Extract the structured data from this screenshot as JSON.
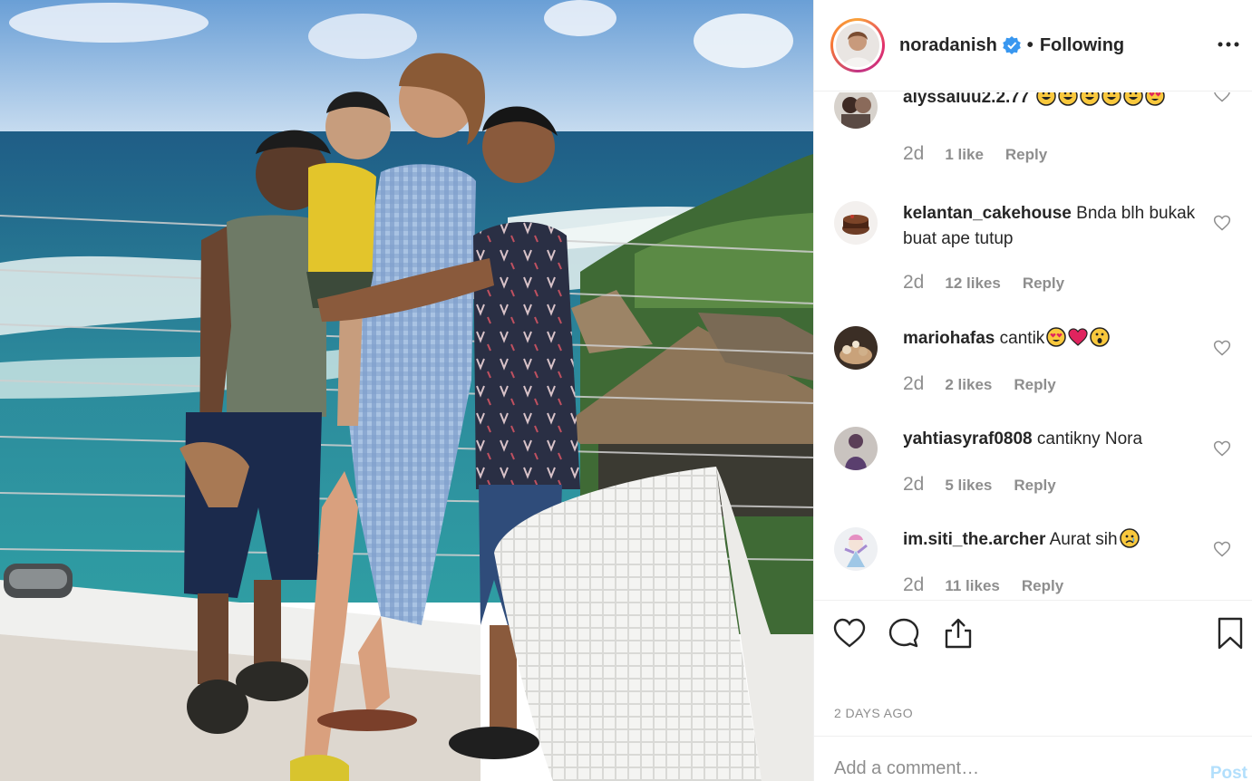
{
  "header": {
    "username": "noradanish",
    "separator": "•",
    "follow_status": "Following"
  },
  "comments": [
    {
      "username": "alyssaluu2.2.77",
      "text": "",
      "emojis": [
        "grin",
        "grin",
        "grin",
        "grin",
        "grin",
        "heart-eyes"
      ],
      "time": "2d",
      "likes": "1 like",
      "reply": "Reply"
    },
    {
      "username": "kelantan_cakehouse",
      "text": "Bnda blh bukak buat ape tutup",
      "emojis": [],
      "time": "2d",
      "likes": "12 likes",
      "reply": "Reply"
    },
    {
      "username": "mariohafas",
      "text": "cantik",
      "emojis": [
        "heart-eyes",
        "red-heart",
        "surprised"
      ],
      "time": "2d",
      "likes": "2 likes",
      "reply": "Reply"
    },
    {
      "username": "yahtiasyraf0808",
      "text": "cantikny Nora",
      "emojis": [],
      "time": "2d",
      "likes": "5 likes",
      "reply": "Reply"
    },
    {
      "username": "im.siti_the.archer",
      "text": "Aurat sih",
      "emojis": [
        "sad"
      ],
      "time": "2d",
      "likes": "11 likes",
      "reply": "Reply"
    }
  ],
  "timestamp": "2 DAYS AGO",
  "add_comment": {
    "placeholder": "Add a comment…",
    "post_label": "Post"
  },
  "colors": {
    "verified": "#3897f0",
    "post_disabled": "#b2dffc",
    "muted": "#8e8e8e"
  }
}
